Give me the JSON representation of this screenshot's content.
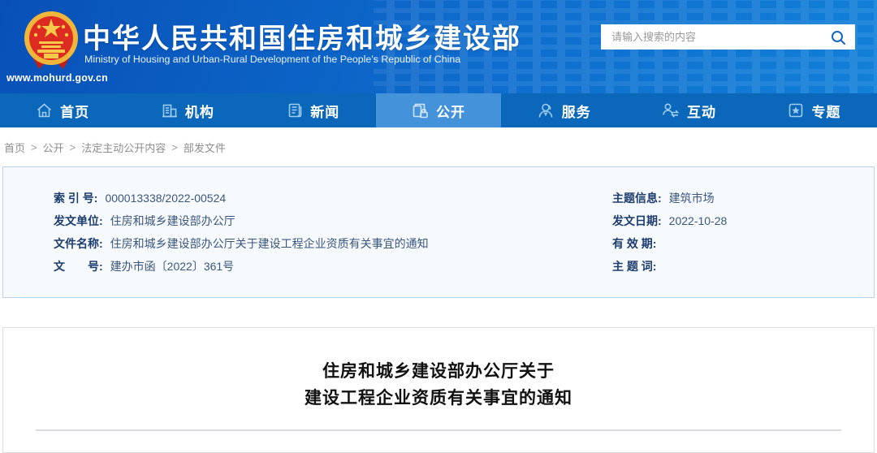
{
  "header": {
    "site_url": "www.mohurd.gov.cn",
    "title_cn": "中华人民共和国住房和城乡建设部",
    "title_en": "Ministry of Housing and Urban-Rural Development of the People's Republic of China",
    "search": {
      "placeholder": "请输入搜索的内容"
    }
  },
  "nav": {
    "items": [
      {
        "label": "首页",
        "icon": "home-icon",
        "active": false
      },
      {
        "label": "机构",
        "icon": "building-icon",
        "active": false
      },
      {
        "label": "新闻",
        "icon": "news-icon",
        "active": false
      },
      {
        "label": "公开",
        "icon": "document-lock-icon",
        "active": true
      },
      {
        "label": "服务",
        "icon": "service-person-icon",
        "active": false
      },
      {
        "label": "互动",
        "icon": "interaction-arrows-icon",
        "active": false
      },
      {
        "label": "专题",
        "icon": "star-box-icon",
        "active": false
      }
    ]
  },
  "breadcrumb": {
    "separator": ">",
    "parts": [
      "首页",
      "公开",
      "法定主动公开内容",
      "部发文件"
    ]
  },
  "doc_meta": {
    "left": [
      {
        "label": "索 引 号:",
        "value": "000013338/2022-00524"
      },
      {
        "label": "发文单位:",
        "value": "住房和城乡建设部办公厅"
      },
      {
        "label": "文件名称:",
        "value": "住房和城乡建设部办公厅关于建设工程企业资质有关事宜的通知"
      },
      {
        "label": "文　　号:",
        "value": "建办市函〔2022〕361号"
      }
    ],
    "right": [
      {
        "label": "主题信息:",
        "value": "建筑市场"
      },
      {
        "label": "发文日期:",
        "value": "2022-10-28"
      },
      {
        "label": "有 效 期:",
        "value": ""
      },
      {
        "label": "主 题 词:",
        "value": ""
      }
    ]
  },
  "article": {
    "title_line1": "住房和城乡建设部办公厅关于",
    "title_line2": "建设工程企业资质有关事宜的通知"
  },
  "colors": {
    "header_blue_dark": "#0850b8",
    "header_blue_light": "#1280d8",
    "nav_blue": "#0a67b9",
    "nav_active_blue": "#4392da",
    "nav_icon_blue": "#9ecbf0",
    "meta_border": "#b9d3ea",
    "meta_bg": "#f7fafd",
    "meta_label": "#1d3c6e",
    "meta_value": "#3a567f",
    "breadcrumb_gray": "#8e8e8e",
    "emblem_gold": "#f0b63c",
    "emblem_red": "#dc2b20"
  }
}
